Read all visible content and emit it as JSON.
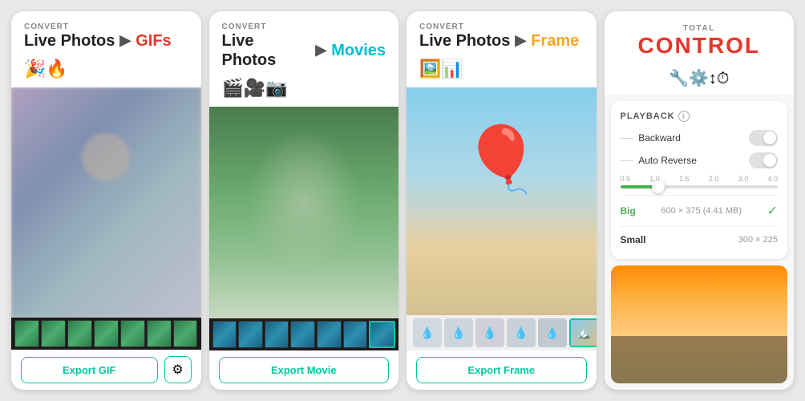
{
  "screens": [
    {
      "id": "gif-screen",
      "convert_label": "CONVERT",
      "source": "Live Photos",
      "arrow": "▶",
      "target": "GIFs",
      "target_class": "target-gif",
      "icons": "🎉🔥",
      "export_btn": "Export GIF",
      "has_settings": true,
      "settings_icon": "⚙"
    },
    {
      "id": "movie-screen",
      "convert_label": "CONVERT",
      "source": "Live Photos",
      "arrow": "▶",
      "target": "Movies",
      "target_class": "target-movie",
      "icons": "🎬🎥📷",
      "export_btn": "Export Movie",
      "has_settings": false
    },
    {
      "id": "frame-screen",
      "convert_label": "CONVERT",
      "source": "Live Photos",
      "arrow": "▶",
      "target": "Frame",
      "target_class": "target-frame",
      "icons": "🖼️📊",
      "export_btn": "Export Frame",
      "has_settings": false,
      "thumbs": [
        "💧",
        "💧",
        "💧",
        "💧",
        "💧",
        "🖼️"
      ]
    }
  ],
  "control_screen": {
    "total_label": "TOTAL",
    "control_title": "CONTROL",
    "icons": "🔧⚙️↕⏱",
    "playback_section": {
      "title": "PLAYBACK",
      "backward_label": "Backward",
      "backward_sub": "–––",
      "auto_reverse_label": "Auto Reverse",
      "auto_reverse_sub": "–––",
      "speed_labels": [
        "0.5",
        "1.0",
        "1.5",
        "2.0",
        "3.0",
        "4.0"
      ],
      "sizes": [
        {
          "label": "Big",
          "dims": "600 × 375 (4.41 MB)",
          "selected": true
        },
        {
          "label": "Small",
          "dims": "300 × 225",
          "selected": false
        }
      ]
    }
  }
}
